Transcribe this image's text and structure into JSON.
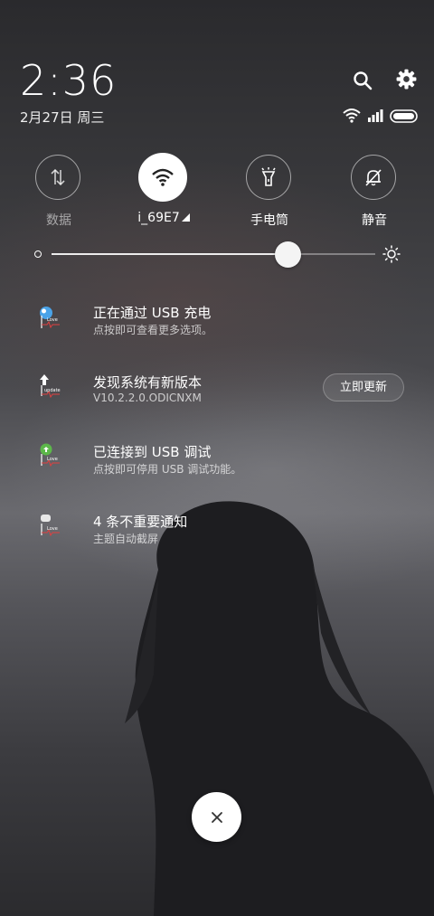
{
  "header": {
    "time": "2:36",
    "date": "2月27日 周三",
    "search_icon": "search-icon",
    "settings_icon": "gear-icon"
  },
  "status_bar": {
    "icons": [
      "wifi-icon",
      "cellular-signal-icon",
      "battery-icon"
    ]
  },
  "quick_toggles": [
    {
      "label": "数据",
      "icon": "data-arrows-icon",
      "active": false
    },
    {
      "label": "i_69E7",
      "icon": "wifi-icon",
      "active": true
    },
    {
      "label": "手电筒",
      "icon": "flashlight-icon",
      "active": false
    },
    {
      "label": "静音",
      "icon": "bell-off-icon",
      "active": false
    }
  ],
  "brightness": {
    "level": 0.73,
    "min_icon": "brightness-low-icon",
    "max_icon": "sun-icon"
  },
  "notifications": [
    {
      "title": "正在通过 USB 充电",
      "subtitle": "点按即可查看更多选项。",
      "icon": "usb-charge-app-icon"
    },
    {
      "title": "发现系统有新版本",
      "subtitle": "V10.2.2.0.ODICNXM",
      "icon": "update-app-icon",
      "action": "立即更新"
    },
    {
      "title": "已连接到 USB 调试",
      "subtitle": "点按即可停用 USB 调试功能。",
      "icon": "usb-debug-app-icon"
    },
    {
      "title": "4 条不重要通知",
      "subtitle": "主题自动截屏",
      "icon": "theme-app-icon"
    }
  ],
  "close_button": {
    "icon": "close-icon"
  },
  "colors": {
    "text": "#ffffff",
    "active_toggle_bg": "#ffffff",
    "active_toggle_icon": "#222222"
  }
}
